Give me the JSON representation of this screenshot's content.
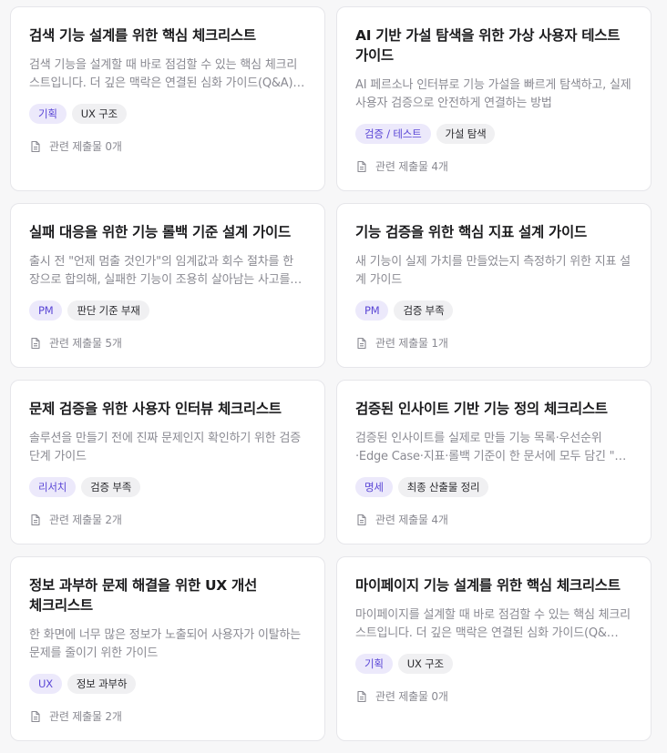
{
  "cards": [
    {
      "title": "검색 기능 설계를 위한 핵심 체크리스트",
      "description": "검색 기능을 설계할 때 바로 점검할 수 있는 핵심 체크리스트입니다. 더 깊은 맥락은 연결된 심화 가이드(Q&A)…",
      "tags": [
        "기획",
        "UX 구조"
      ],
      "submissions": "관련 제출물 0개",
      "icon": "document-icon"
    },
    {
      "title": "AI 기반 가설 탐색을 위한 가상 사용자 테스트 가이드",
      "description": "AI 페르소나 인터뷰로 기능 가설을 빠르게 탐색하고, 실제 사용자 검증으로 안전하게 연결하는 방법",
      "tags": [
        "검증 / 테스트",
        "가설 탐색"
      ],
      "submissions": "관련 제출물 4개",
      "icon": "document-icon"
    },
    {
      "title": "실패 대응을 위한 기능 롤백 기준 설계 가이드",
      "description": "출시 전 \"언제 멈출 것인가\"의 임계값과 회수 절차를 한 장으로 합의해, 실패한 기능이 조용히 살아남는 사고를…",
      "tags": [
        "PM",
        "판단 기준 부재"
      ],
      "submissions": "관련 제출물 5개",
      "icon": "document-icon"
    },
    {
      "title": "기능 검증을 위한 핵심 지표 설계 가이드",
      "description": "새 기능이 실제 가치를 만들었는지 측정하기 위한 지표 설계 가이드",
      "tags": [
        "PM",
        "검증 부족"
      ],
      "submissions": "관련 제출물 1개",
      "icon": "document-icon"
    },
    {
      "title": "문제 검증을 위한 사용자 인터뷰 체크리스트",
      "description": "솔루션을 만들기 전에 진짜 문제인지 확인하기 위한 검증 단계 가이드",
      "tags": [
        "리서치",
        "검증 부족"
      ],
      "submissions": "관련 제출물 2개",
      "icon": "document-icon"
    },
    {
      "title": "검증된 인사이트 기반 기능 정의 체크리스트",
      "description": "검증된 인사이트를 실제로 만들 기능 목록·우선순위·Edge Case·지표·롤백 기준이 한 문서에 모두 담긴 \"…",
      "tags": [
        "명세",
        "최종 산출물 정리"
      ],
      "submissions": "관련 제출물 4개",
      "icon": "document-icon"
    },
    {
      "title": "정보 과부하 문제 해결을 위한 UX 개선 체크리스트",
      "description": "한 화면에 너무 많은 정보가 노출되어 사용자가 이탈하는 문제를 줄이기 위한 가이드",
      "tags": [
        "UX",
        "정보 과부하"
      ],
      "submissions": "관련 제출물 2개",
      "icon": "document-icon"
    },
    {
      "title": "마이페이지 기능 설계를 위한 핵심 체크리스트",
      "description": "마이페이지를 설계할 때 바로 점검할 수 있는 핵심 체크리스트입니다. 더 깊은 맥락은 연결된 심화 가이드(Q&…",
      "tags": [
        "기획",
        "UX 구조"
      ],
      "submissions": "관련 제출물 0개",
      "icon": "document-icon"
    }
  ]
}
